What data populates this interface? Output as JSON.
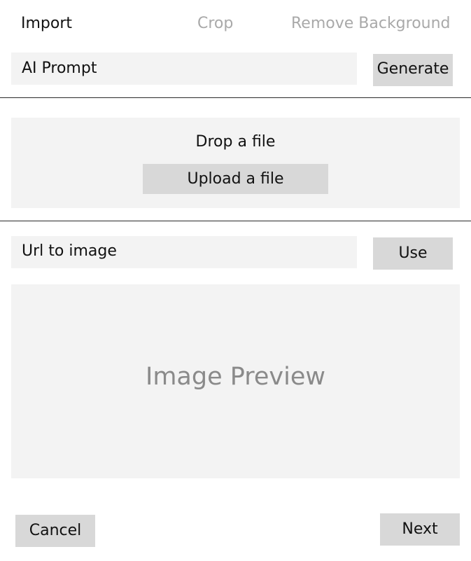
{
  "tabs": [
    {
      "label": "Import",
      "active": true
    },
    {
      "label": "Crop",
      "active": false
    },
    {
      "label": "Remove Background",
      "active": false
    }
  ],
  "ai_prompt": {
    "placeholder": "AI Prompt",
    "button_label": "Generate"
  },
  "dropzone": {
    "text": "Drop a file",
    "upload_label": "Upload a file"
  },
  "url_input": {
    "placeholder": "Url to image",
    "button_label": "Use"
  },
  "preview": {
    "label": "Image Preview"
  },
  "footer": {
    "cancel_label": "Cancel",
    "next_label": "Next"
  },
  "colors": {
    "field_bg": "#f3f3f3",
    "button_bg": "#d8d8d8",
    "inactive_tab": "#a9a9a9",
    "preview_text": "#8a8a8a"
  }
}
